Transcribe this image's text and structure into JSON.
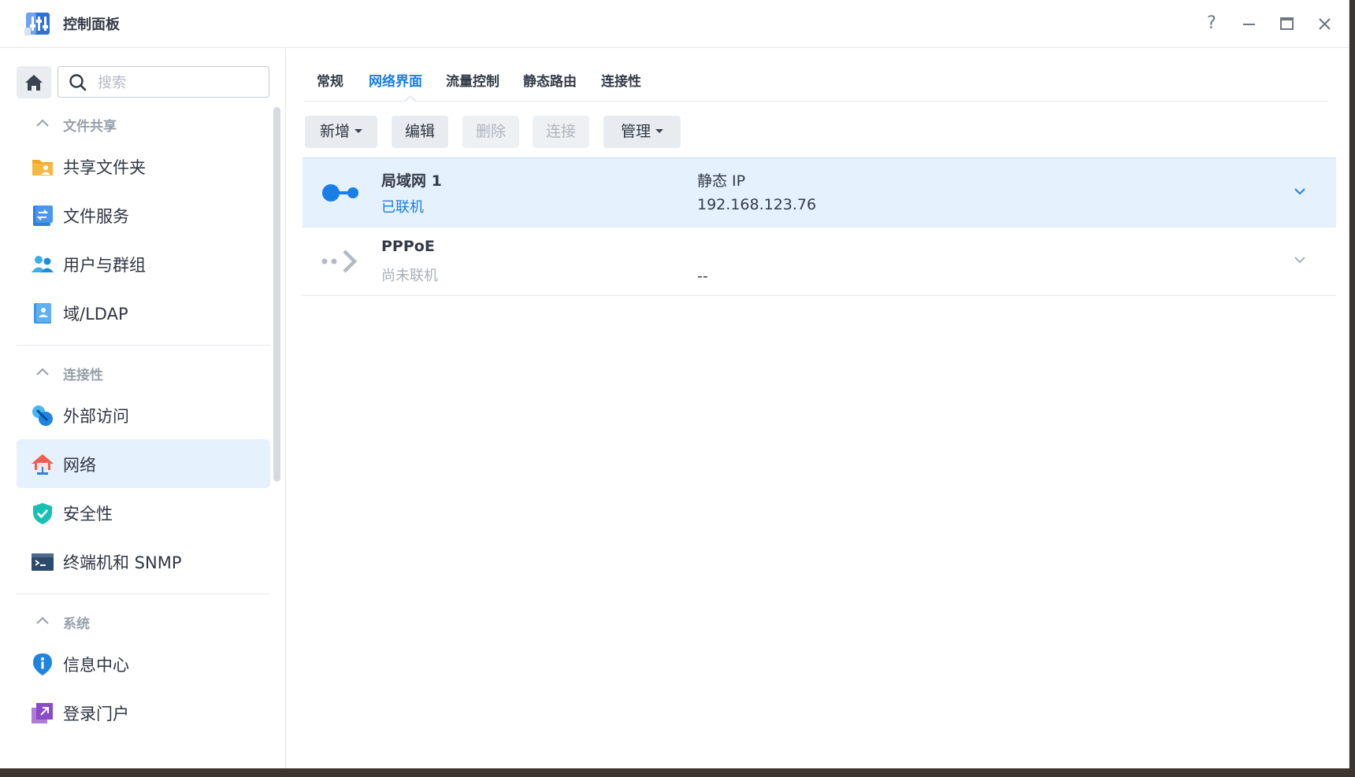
{
  "window": {
    "title": "控制面板",
    "help_glyph": "?",
    "colors": {
      "accent": "#1a7ee6",
      "selected_bg": "#e5f1fc"
    }
  },
  "search": {
    "placeholder": "搜索",
    "value": ""
  },
  "sidebar": {
    "sections": [
      {
        "title": "文件共享",
        "items": [
          {
            "label": "共享文件夹",
            "icon": "shared-folder-icon"
          },
          {
            "label": "文件服务",
            "icon": "file-services-icon"
          },
          {
            "label": "用户与群组",
            "icon": "users-groups-icon"
          },
          {
            "label": "域/LDAP",
            "icon": "domain-ldap-icon"
          }
        ]
      },
      {
        "title": "连接性",
        "items": [
          {
            "label": "外部访问",
            "icon": "external-access-icon"
          },
          {
            "label": "网络",
            "icon": "network-house-icon",
            "active": true
          },
          {
            "label": "安全性",
            "icon": "security-shield-icon"
          },
          {
            "label": "终端机和 SNMP",
            "icon": "terminal-icon"
          }
        ]
      },
      {
        "title": "系统",
        "items": [
          {
            "label": "信息中心",
            "icon": "info-center-icon"
          },
          {
            "label": "登录门户",
            "icon": "login-portal-icon"
          }
        ]
      }
    ]
  },
  "tabs": [
    {
      "label": "常规"
    },
    {
      "label": "网络界面",
      "active": true
    },
    {
      "label": "流量控制"
    },
    {
      "label": "静态路由"
    },
    {
      "label": "连接性"
    }
  ],
  "toolbar": {
    "create_label": "新增",
    "edit_label": "编辑",
    "delete_label": "删除",
    "connect_label": "连接",
    "manage_label": "管理"
  },
  "interfaces": [
    {
      "name": "局域网 1",
      "status": "已联机",
      "status_color": "#1a7ee6",
      "connection_type": "静态 IP",
      "ip": "192.168.123.76",
      "icon": "lan-connected-icon",
      "selected": true
    },
    {
      "name": "PPPoE",
      "status": "尚未联机",
      "status_color": "#a9b0b8",
      "connection_type": "",
      "ip": "--",
      "icon": "pppoe-disconnected-icon",
      "selected": false
    }
  ]
}
